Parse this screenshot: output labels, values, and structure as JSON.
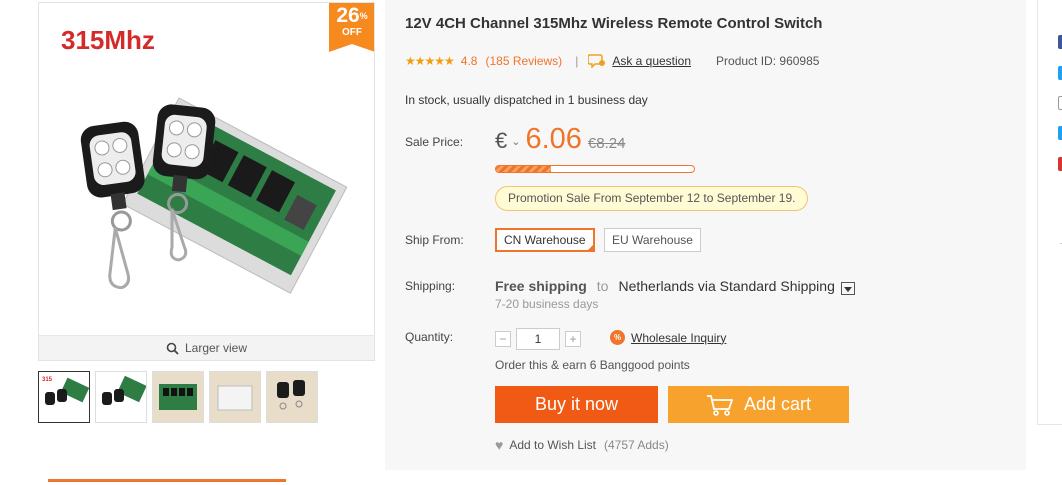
{
  "gallery": {
    "main_image_text": "315Mhz",
    "badge": {
      "percent": "26",
      "percent_sign": "%",
      "off": "OFF"
    },
    "larger_view": "Larger view",
    "thumbnails": [
      "remote-pair-and-board",
      "remote-pair-and-board-2",
      "relay-board",
      "plastic-case",
      "remote-pair"
    ]
  },
  "product": {
    "title": "12V 4CH Channel 315Mhz Wireless Remote Control Switch",
    "stars": "★★★★★",
    "rating": "4.8",
    "reviews": "(185 Reviews)",
    "separator": "|",
    "ask": "Ask a question",
    "product_id": "Product ID: 960985",
    "stock": "In stock, usually dispatched in 1 business day"
  },
  "price": {
    "label": "Sale Price:",
    "currency": "€",
    "caret": "⌄",
    "current": "6.06",
    "old": "€8.24",
    "sold_fraction": 0.28,
    "promo": "Promotion Sale From September 12 to September 19."
  },
  "ship_from": {
    "label": "Ship From:",
    "options": [
      "CN Warehouse",
      "EU Warehouse"
    ],
    "selected": "CN Warehouse"
  },
  "shipping": {
    "label": "Shipping:",
    "free": "Free shipping",
    "to": "to",
    "destination": "Netherlands via Standard Shipping",
    "days": "7-20 business days"
  },
  "quantity": {
    "label": "Quantity:",
    "minus": "−",
    "value": "1",
    "plus": "+",
    "wholesale_icon": "%",
    "wholesale": "Wholesale Inquiry"
  },
  "points": "Order this & earn 6 Banggood points",
  "actions": {
    "buy": "Buy it now",
    "cart": "Add cart",
    "wish": "Add to Wish List",
    "wish_count": "(4757 Adds)"
  },
  "colors": {
    "accent": "#f0752a",
    "buy_button": "#f05a14",
    "cart_button": "#f7a22d",
    "badge": "#f78a1e"
  }
}
